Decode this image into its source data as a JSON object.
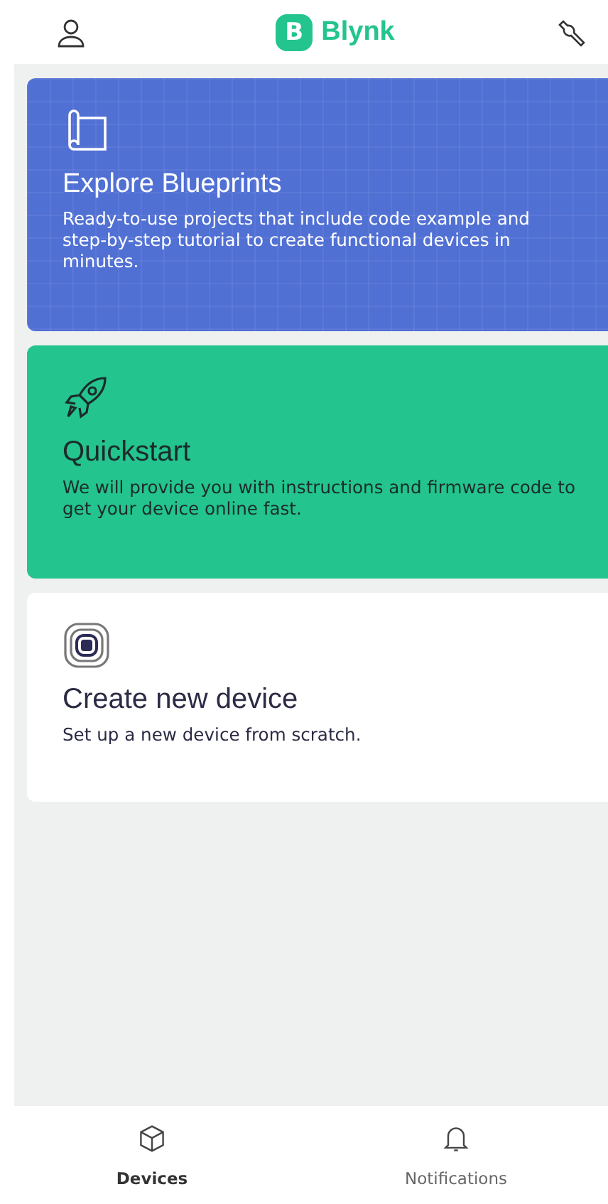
{
  "header": {
    "logo_letter": "B",
    "logo_text": "Blynk"
  },
  "cards": [
    {
      "kind": "blueprints",
      "title": "Explore Blueprints",
      "description": "Ready-to-use projects that include code example and step-by-step tutorial to create functional devices in minutes."
    },
    {
      "kind": "quickstart",
      "title": "Quickstart",
      "description": "We will provide you with instructions and firmware code to get your device online fast."
    },
    {
      "kind": "device",
      "title": "Create new device",
      "description": "Set up a new device from scratch."
    }
  ],
  "tabs": [
    {
      "kind": "devices",
      "label": "Devices",
      "selected": true
    },
    {
      "kind": "notifications",
      "label": "Notifications",
      "selected": false
    }
  ]
}
